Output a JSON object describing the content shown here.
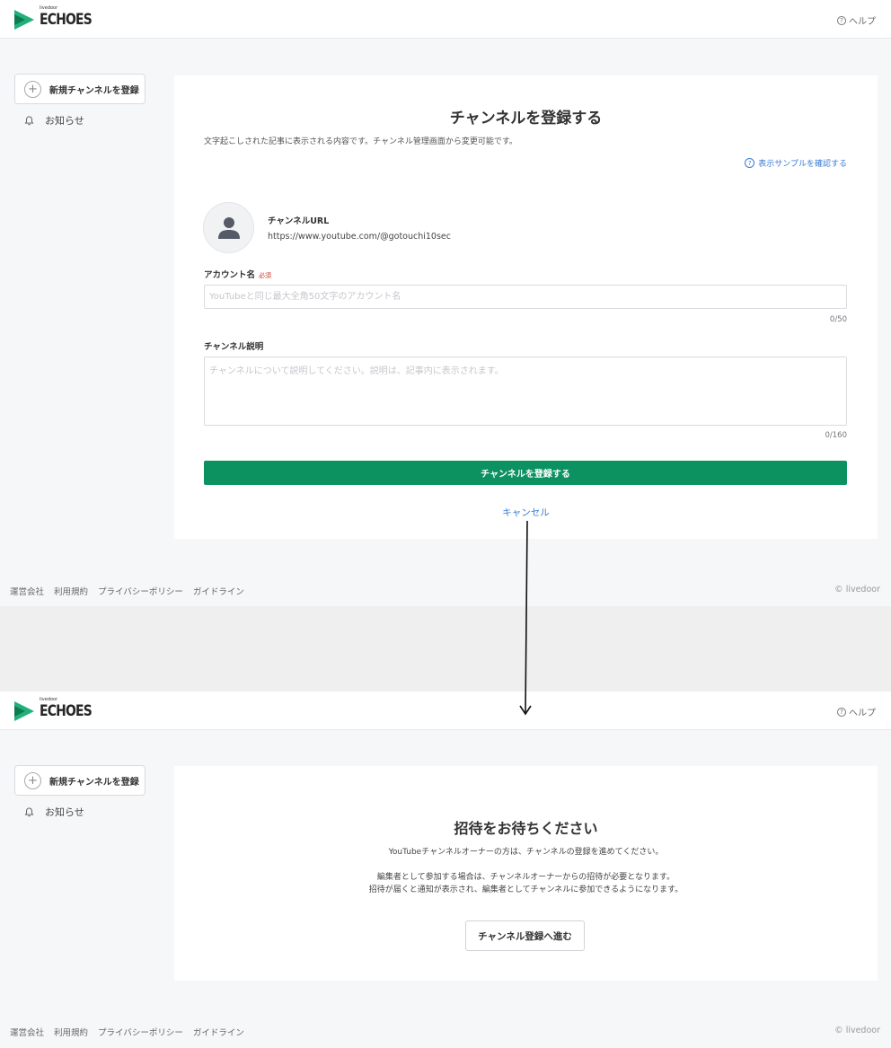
{
  "header": {
    "logo_small": "livedoor",
    "logo_text": "ECHOES",
    "help_label": "ヘルプ"
  },
  "sidebar": {
    "new_channel_label": "新規チャンネルを登録",
    "notice_label": "お知らせ"
  },
  "register": {
    "title": "チャンネルを登録する",
    "description": "文字起こしされた記事に表示される内容です。チャンネル管理画面から変更可能です。",
    "sample_link": "表示サンプルを確認する",
    "channel_url_label": "チャンネルURL",
    "channel_url_value": "https://www.youtube.com/@gotouchi10sec",
    "account_name_label": "アカウント名",
    "required_badge": "必須",
    "account_name_value": "",
    "account_name_placeholder": "YouTubeと同じ最大全角50文字のアカウント名",
    "account_name_counter": "0/50",
    "description_label": "チャンネル説明",
    "description_value": "",
    "description_placeholder": "チャンネルについて説明してください。説明は、記事内に表示されます。",
    "description_counter": "0/160",
    "submit_label": "チャンネルを登録する",
    "cancel_label": "キャンセル"
  },
  "invite": {
    "title": "招待をお待ちください",
    "line1": "YouTubeチャンネルオーナーの方は、チャンネルの登録を進めてください。",
    "line2": "編集者として参加する場合は、チャンネルオーナーからの招待が必要となります。",
    "line3": "招待が届くと通知が表示され、編集者としてチャンネルに参加できるようになります。",
    "proceed_label": "チャンネル登録へ進む"
  },
  "footer": {
    "links": [
      "運営会社",
      "利用規約",
      "プライバシーポリシー",
      "ガイドライン"
    ],
    "copyright": "© livedoor"
  },
  "colors": {
    "brand_green": "#0c9161",
    "link_blue": "#3a7bd5",
    "required_red": "#c0392b",
    "page_bg": "#f6f7f9"
  },
  "icons": [
    "logo-play-icon",
    "help-icon",
    "plus-icon",
    "bell-icon",
    "user-icon",
    "arrow-down-icon"
  ]
}
